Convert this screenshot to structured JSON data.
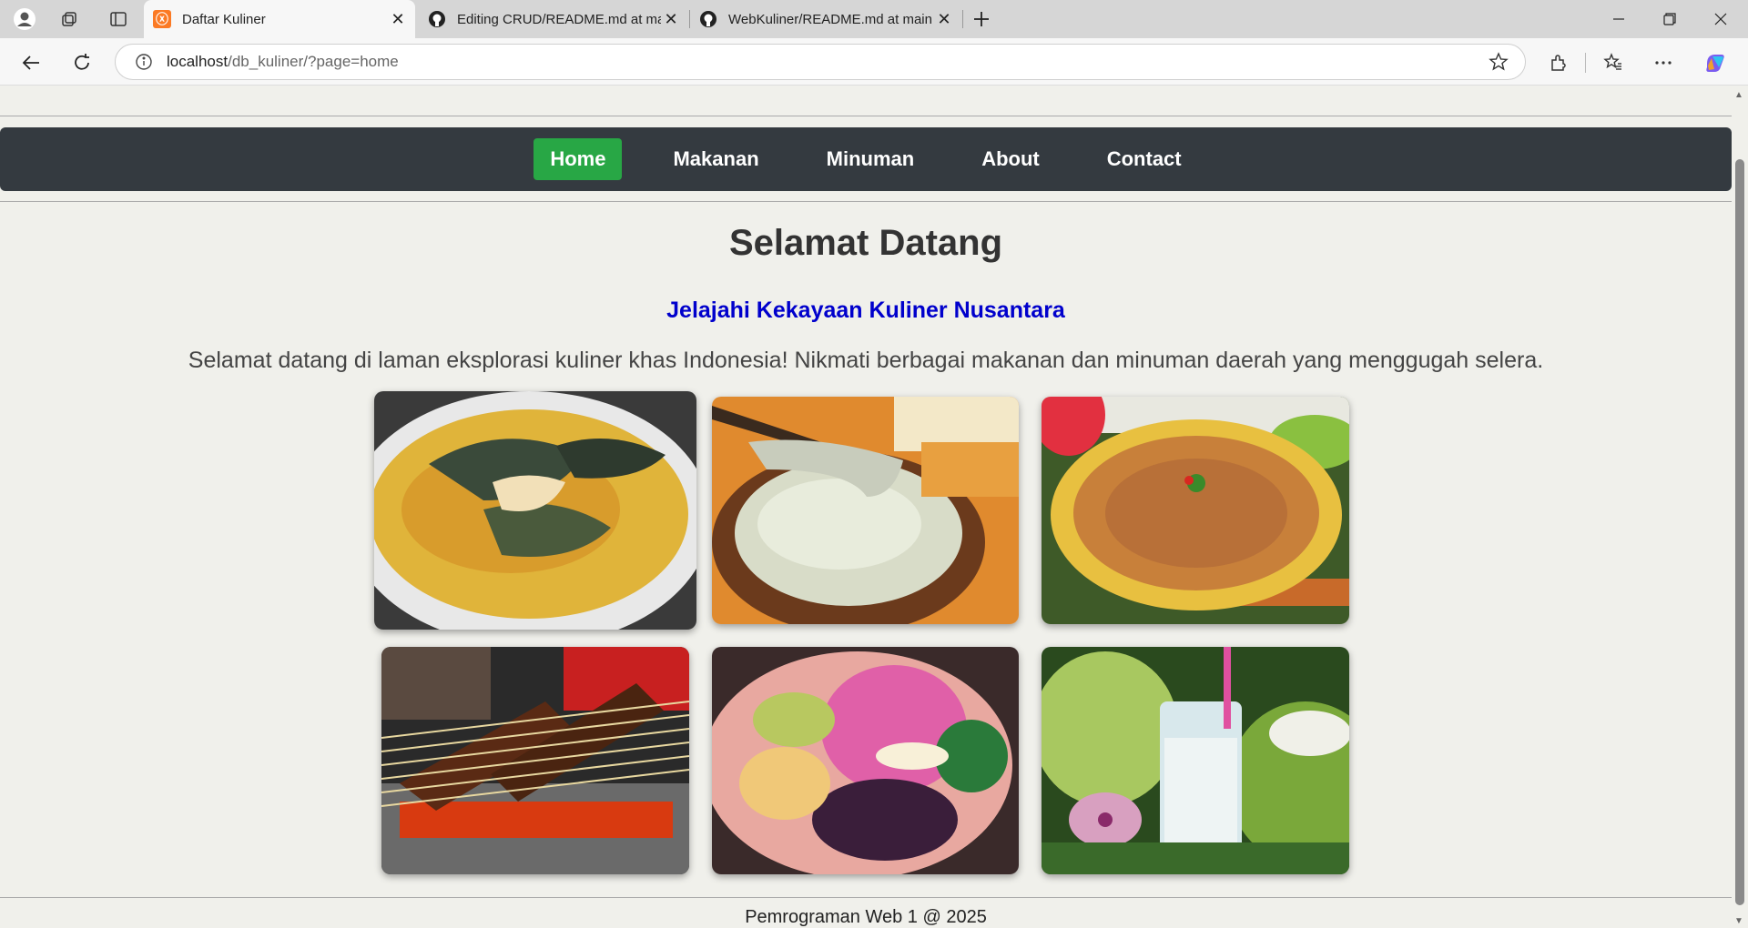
{
  "browser": {
    "tabs": [
      {
        "title": "Daftar Kuliner",
        "icon": "xampp-icon",
        "active": true
      },
      {
        "title": "Editing CRUD/README.md at main",
        "icon": "github-icon",
        "active": false
      },
      {
        "title": "WebKuliner/README.md at main",
        "icon": "github-icon",
        "active": false
      }
    ],
    "url_host": "localhost",
    "url_path": "/db_kuliner/?page=home"
  },
  "nav": {
    "items": [
      {
        "label": "Home",
        "active": true
      },
      {
        "label": "Makanan",
        "active": false
      },
      {
        "label": "Minuman",
        "active": false
      },
      {
        "label": "About",
        "active": false
      },
      {
        "label": "Contact",
        "active": false
      }
    ],
    "active_color": "#28a745",
    "bar_color": "#343a40"
  },
  "main": {
    "title": "Selamat Datang",
    "subtitle": "Jelajahi Kekayaan Kuliner Nusantara",
    "intro": "Selamat datang di laman eksplorasi kuliner khas Indonesia! Nikmati berbagai makanan dan minuman daerah yang menggugah selera.",
    "subtitle_color": "#0000cc"
  },
  "gallery": [
    {
      "name": "fish-soup-photo"
    },
    {
      "name": "papeda-photo"
    },
    {
      "name": "kerak-telor-photo"
    },
    {
      "name": "sate-photo"
    },
    {
      "name": "es-campur-photo"
    },
    {
      "name": "es-kelapa-photo"
    }
  ],
  "footer": {
    "text": "Pemrograman Web 1 @ 2025"
  }
}
